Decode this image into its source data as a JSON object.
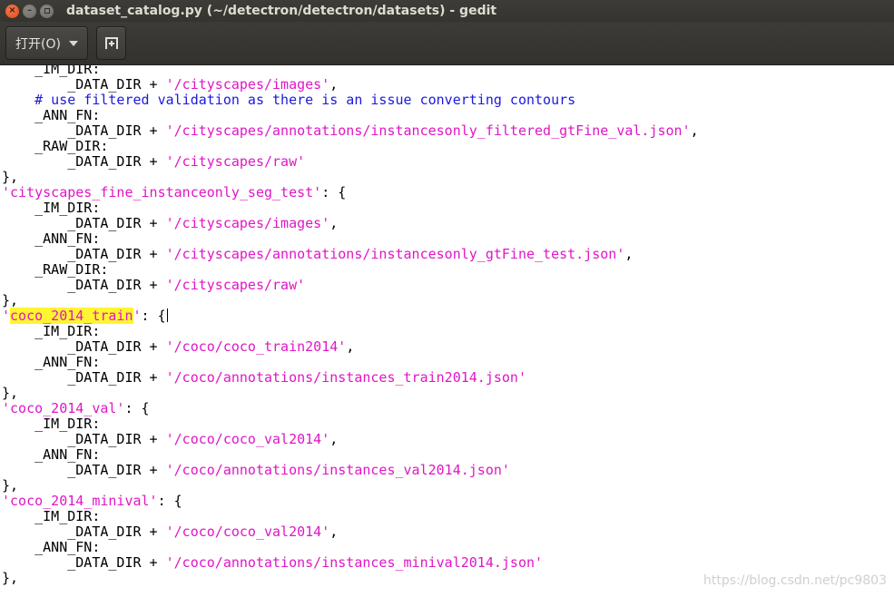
{
  "window": {
    "title": "dataset_catalog.py (~/detectron/detectron/datasets) - gedit"
  },
  "toolbar": {
    "open_label": "打开(O)"
  },
  "editor": {
    "lines": [
      [
        {
          "t": "    _IM_DIR:"
        }
      ],
      [
        {
          "t": "        _DATA_DIR + "
        },
        {
          "t": "'/cityscapes/images'",
          "k": "s"
        },
        {
          "t": ","
        }
      ],
      [
        {
          "t": "    "
        },
        {
          "t": "# use filtered validation as there is an issue converting contours",
          "k": "c"
        }
      ],
      [
        {
          "t": "    _ANN_FN:"
        }
      ],
      [
        {
          "t": "        _DATA_DIR + "
        },
        {
          "t": "'/cityscapes/annotations/instancesonly_filtered_gtFine_val.json'",
          "k": "s"
        },
        {
          "t": ","
        }
      ],
      [
        {
          "t": "    _RAW_DIR:"
        }
      ],
      [
        {
          "t": "        _DATA_DIR + "
        },
        {
          "t": "'/cityscapes/raw'",
          "k": "s"
        }
      ],
      [
        {
          "t": "},"
        }
      ],
      [
        {
          "t": "'cityscapes_fine_instanceonly_seg_test'",
          "k": "s"
        },
        {
          "t": ": {"
        }
      ],
      [
        {
          "t": "    _IM_DIR:"
        }
      ],
      [
        {
          "t": "        _DATA_DIR + "
        },
        {
          "t": "'/cityscapes/images'",
          "k": "s"
        },
        {
          "t": ","
        }
      ],
      [
        {
          "t": "    _ANN_FN:"
        }
      ],
      [
        {
          "t": "        _DATA_DIR + "
        },
        {
          "t": "'/cityscapes/annotations/instancesonly_gtFine_test.json'",
          "k": "s"
        },
        {
          "t": ","
        }
      ],
      [
        {
          "t": "    _RAW_DIR:"
        }
      ],
      [
        {
          "t": "        _DATA_DIR + "
        },
        {
          "t": "'/cityscapes/raw'",
          "k": "s"
        }
      ],
      [
        {
          "t": "},"
        }
      ],
      [
        {
          "t": "'",
          "k": "s"
        },
        {
          "t": "coco_2014_train",
          "k": "sh"
        },
        {
          "t": "'",
          "k": "s"
        },
        {
          "t": ": {"
        },
        {
          "t": "",
          "k": "cursor"
        }
      ],
      [
        {
          "t": "    _IM_DIR:"
        }
      ],
      [
        {
          "t": "        _DATA_DIR + "
        },
        {
          "t": "'/coco/coco_train2014'",
          "k": "s"
        },
        {
          "t": ","
        }
      ],
      [
        {
          "t": "    _ANN_FN:"
        }
      ],
      [
        {
          "t": "        _DATA_DIR + "
        },
        {
          "t": "'/coco/annotations/instances_train2014.json'",
          "k": "s"
        }
      ],
      [
        {
          "t": "},"
        }
      ],
      [
        {
          "t": "'coco_2014_val'",
          "k": "s"
        },
        {
          "t": ": {"
        }
      ],
      [
        {
          "t": "    _IM_DIR:"
        }
      ],
      [
        {
          "t": "        _DATA_DIR + "
        },
        {
          "t": "'/coco/coco_val2014'",
          "k": "s"
        },
        {
          "t": ","
        }
      ],
      [
        {
          "t": "    _ANN_FN:"
        }
      ],
      [
        {
          "t": "        _DATA_DIR + "
        },
        {
          "t": "'/coco/annotations/instances_val2014.json'",
          "k": "s"
        }
      ],
      [
        {
          "t": "},"
        }
      ],
      [
        {
          "t": "'coco_2014_minival'",
          "k": "s"
        },
        {
          "t": ": {"
        }
      ],
      [
        {
          "t": "    _IM_DIR:"
        }
      ],
      [
        {
          "t": "        _DATA_DIR + "
        },
        {
          "t": "'/coco/coco_val2014'",
          "k": "s"
        },
        {
          "t": ","
        }
      ],
      [
        {
          "t": "    _ANN_FN:"
        }
      ],
      [
        {
          "t": "        _DATA_DIR + "
        },
        {
          "t": "'/coco/annotations/instances_minival2014.json'",
          "k": "s"
        }
      ],
      [
        {
          "t": "},"
        }
      ]
    ]
  },
  "watermark": "https://blog.csdn.net/pc9803",
  "colors": {
    "string": "#e016c6",
    "comment": "#1a1adc",
    "search_highlight": "#fff530",
    "titlebar": "#3d3c38",
    "close_button": "#df4a16"
  }
}
